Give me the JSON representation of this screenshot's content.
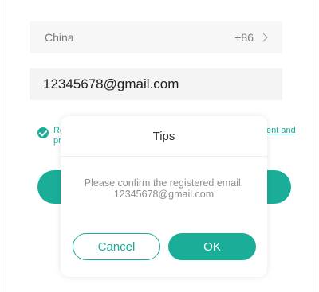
{
  "form": {
    "country_name": "China",
    "country_code": "+86",
    "email_value": "12345678@gmail.com",
    "agreement_line_1": "Re",
    "agreement_line_2": "pr",
    "agreement_link_1": "ent and"
  },
  "dialog": {
    "title": "Tips",
    "message": "Please confirm the registered email: 12345678@gmail.com",
    "cancel_label": "Cancel",
    "ok_label": "OK"
  },
  "colors": {
    "accent": "#1aae98",
    "field_bg": "#f4f4f4"
  },
  "icons": {
    "country_arrow": "chevron-right-icon",
    "agreement_check": "check-circle-icon"
  }
}
